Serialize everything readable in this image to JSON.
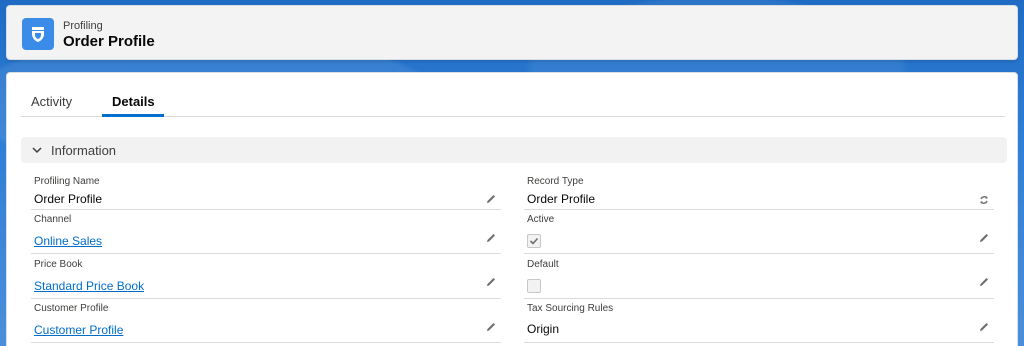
{
  "header": {
    "object_label": "Profiling",
    "record_title": "Order Profile",
    "icon": "profiling-icon"
  },
  "tabs": [
    {
      "label": "Activity",
      "active": false
    },
    {
      "label": "Details",
      "active": true
    }
  ],
  "section": {
    "title": "Information"
  },
  "fields_left": [
    {
      "label": "Profiling Name",
      "value": "Order Profile",
      "type": "text"
    },
    {
      "label": "Channel",
      "value": "Online Sales",
      "type": "link"
    },
    {
      "label": "Price Book",
      "value": "Standard Price Book",
      "type": "link"
    },
    {
      "label": "Customer Profile",
      "value": "Customer Profile",
      "type": "link"
    }
  ],
  "fields_right": [
    {
      "label": "Record Type",
      "value": "Order Profile",
      "type": "text"
    },
    {
      "label": "Active",
      "checked": true,
      "type": "checkbox"
    },
    {
      "label": "Default",
      "checked": false,
      "type": "checkbox"
    },
    {
      "label": "Tax Sourcing Rules",
      "value": "Origin",
      "type": "text"
    }
  ],
  "colors": {
    "brand": "#0070d2",
    "link": "#006dcc",
    "icon_bg": "#3b8ce8"
  }
}
